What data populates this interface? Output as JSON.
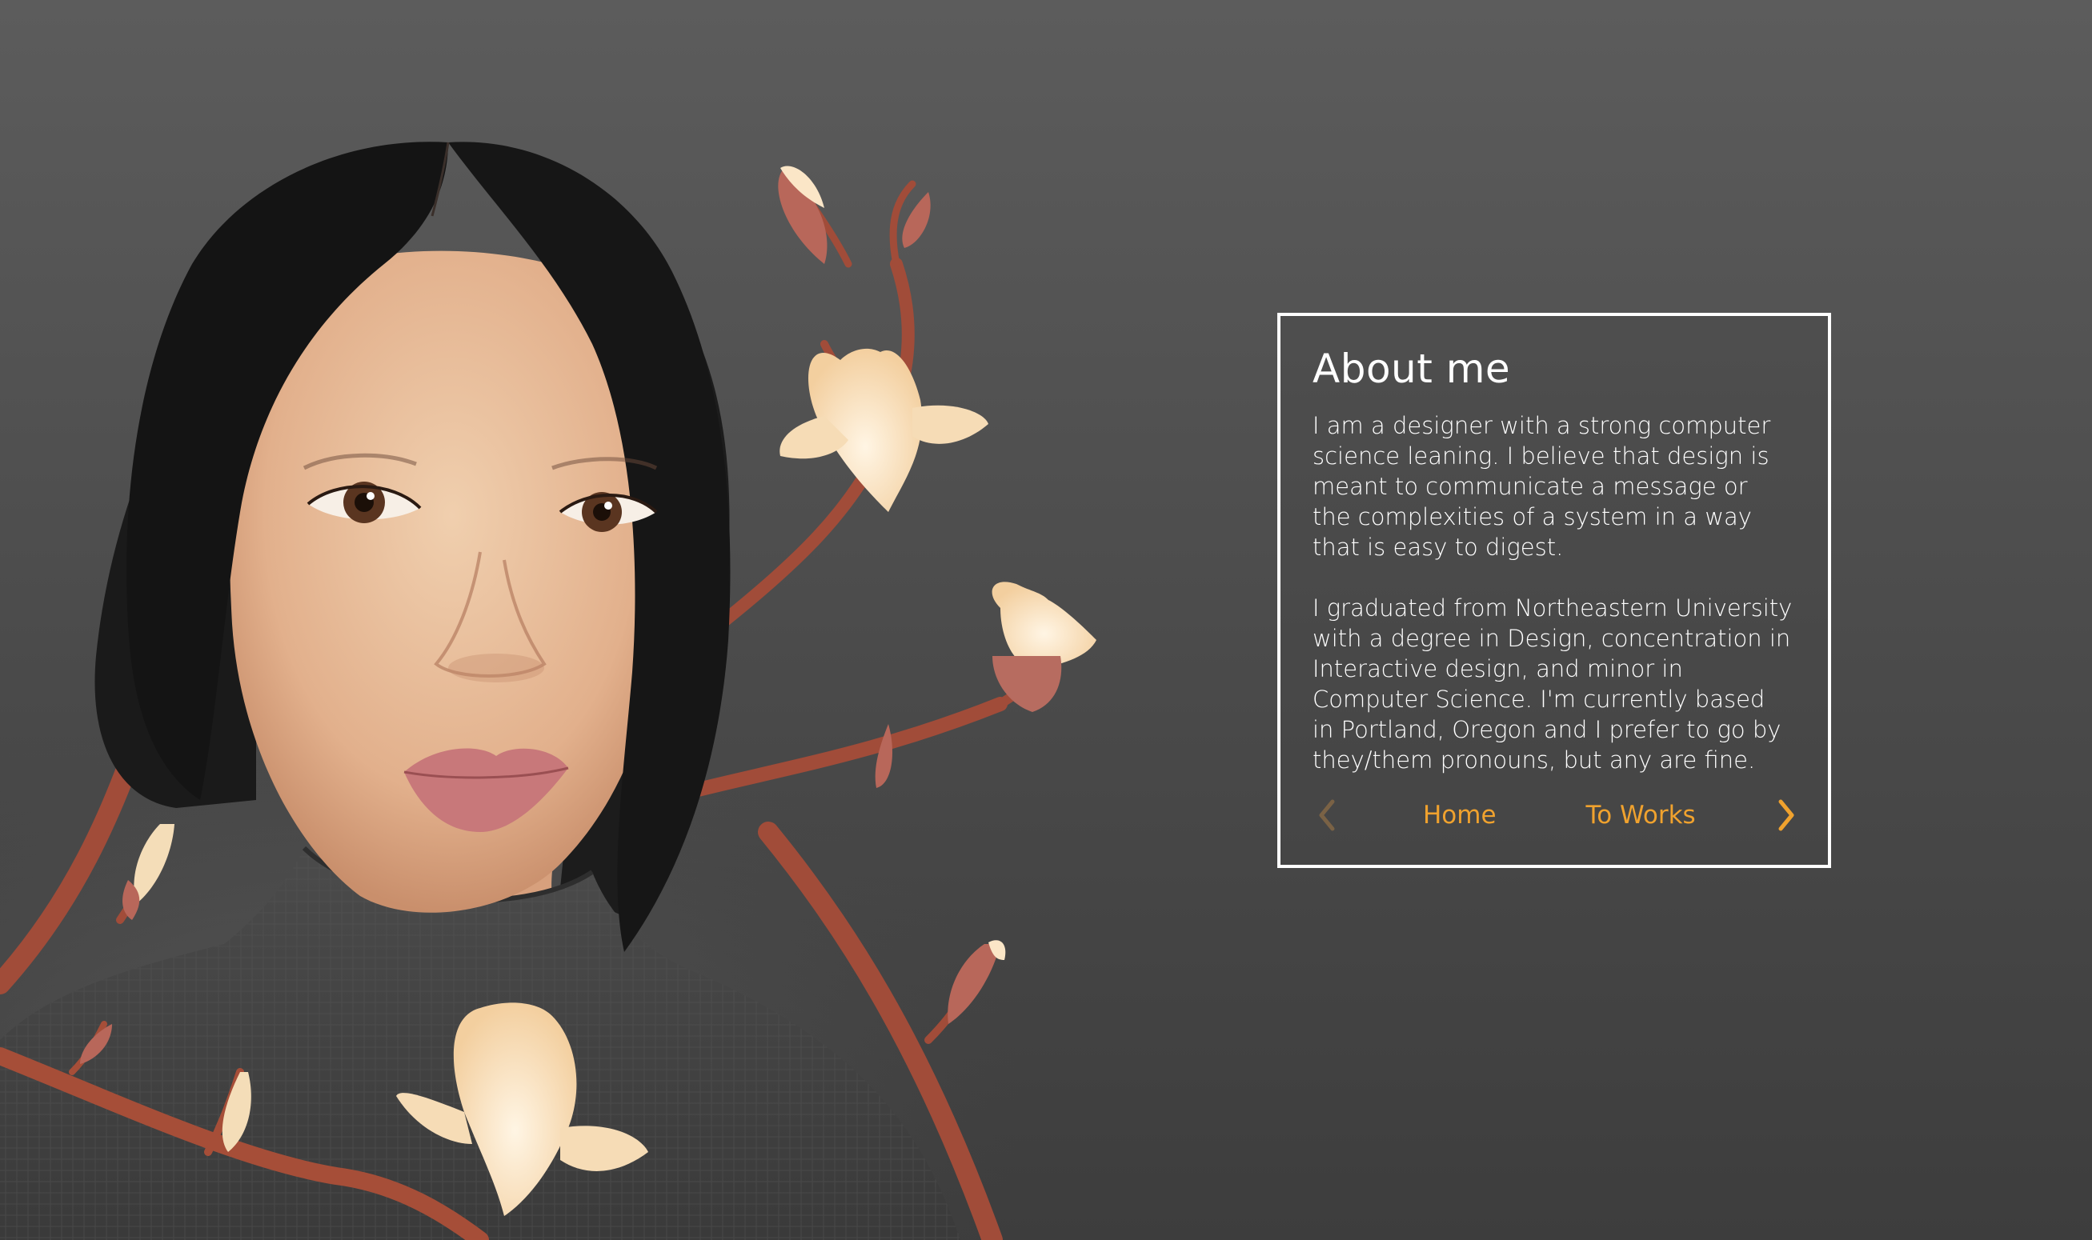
{
  "about": {
    "title": "About me",
    "paragraphs": [
      "I am a designer with a strong computer science leaning. I believe that design is meant to communicate a message or the complexities of a system in a way that is easy to digest.",
      "I graduated from Northeastern University with a degree in Design, concentration in Interactive design, and minor in Computer Science. I'm currently based in Portland, Oregon and I prefer to go by they/them pronouns, but any are fine."
    ]
  },
  "nav": {
    "prev_icon": "chevron-left-icon",
    "home_label": "Home",
    "works_label": "To Works",
    "next_icon": "chevron-right-icon"
  },
  "colors": {
    "accent": "#f0a22e",
    "accent_muted": "#7a6245",
    "card_border": "#ffffff",
    "text": "#ffffff"
  },
  "illustration": {
    "subject": "portrait-illustration"
  }
}
